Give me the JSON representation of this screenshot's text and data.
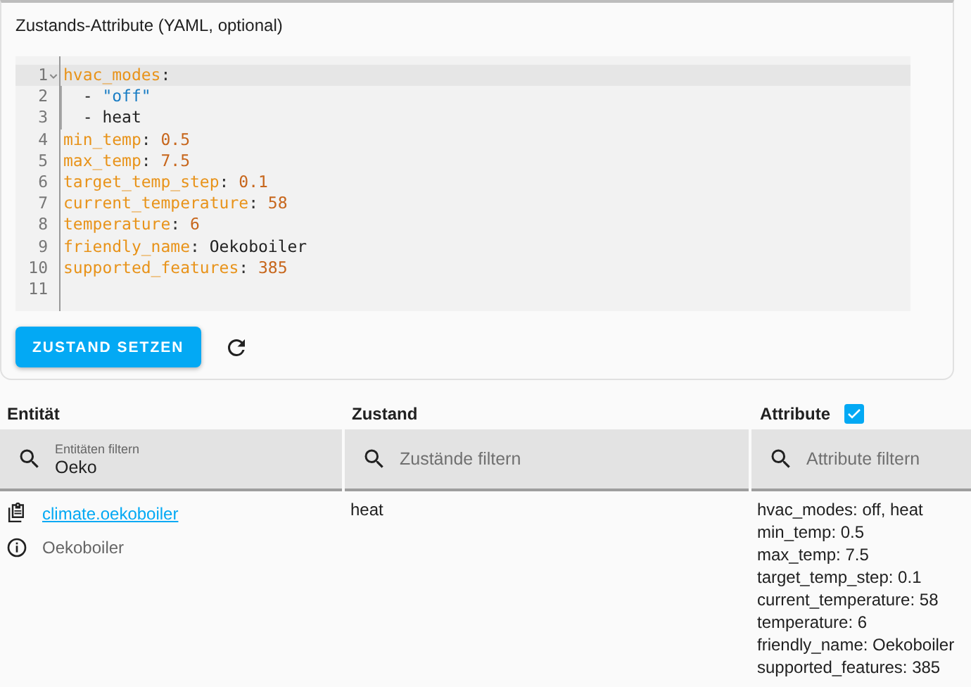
{
  "attributes_card": {
    "label": "Zustands-Attribute (YAML, optional)",
    "editor_lines": [
      {
        "number": "1",
        "foldable": true,
        "active": true,
        "indent_guide": false,
        "tokens": [
          {
            "text": "hvac_modes",
            "kind": "key"
          },
          {
            "text": ":",
            "kind": "punct"
          }
        ]
      },
      {
        "number": "2",
        "foldable": false,
        "active": false,
        "indent_guide": true,
        "tokens": [
          {
            "text": "  - ",
            "kind": "plain"
          },
          {
            "text": "\"off\"",
            "kind": "string"
          }
        ]
      },
      {
        "number": "3",
        "foldable": false,
        "active": false,
        "indent_guide": true,
        "tokens": [
          {
            "text": "  - heat",
            "kind": "plain"
          }
        ]
      },
      {
        "number": "4",
        "foldable": false,
        "active": false,
        "indent_guide": false,
        "tokens": [
          {
            "text": "min_temp",
            "kind": "key"
          },
          {
            "text": ": ",
            "kind": "punct"
          },
          {
            "text": "0.5",
            "kind": "number"
          }
        ]
      },
      {
        "number": "5",
        "foldable": false,
        "active": false,
        "indent_guide": false,
        "tokens": [
          {
            "text": "max_temp",
            "kind": "key"
          },
          {
            "text": ": ",
            "kind": "punct"
          },
          {
            "text": "7.5",
            "kind": "number"
          }
        ]
      },
      {
        "number": "6",
        "foldable": false,
        "active": false,
        "indent_guide": false,
        "tokens": [
          {
            "text": "target_temp_step",
            "kind": "key"
          },
          {
            "text": ": ",
            "kind": "punct"
          },
          {
            "text": "0.1",
            "kind": "number"
          }
        ]
      },
      {
        "number": "7",
        "foldable": false,
        "active": false,
        "indent_guide": false,
        "tokens": [
          {
            "text": "current_temperature",
            "kind": "key"
          },
          {
            "text": ": ",
            "kind": "punct"
          },
          {
            "text": "58",
            "kind": "number"
          }
        ]
      },
      {
        "number": "8",
        "foldable": false,
        "active": false,
        "indent_guide": false,
        "tokens": [
          {
            "text": "temperature",
            "kind": "key"
          },
          {
            "text": ": ",
            "kind": "punct"
          },
          {
            "text": "6",
            "kind": "number"
          }
        ]
      },
      {
        "number": "9",
        "foldable": false,
        "active": false,
        "indent_guide": false,
        "tokens": [
          {
            "text": "friendly_name",
            "kind": "key"
          },
          {
            "text": ": ",
            "kind": "punct"
          },
          {
            "text": "Oekoboiler",
            "kind": "plain"
          }
        ]
      },
      {
        "number": "10",
        "foldable": false,
        "active": false,
        "indent_guide": false,
        "tokens": [
          {
            "text": "supported_features",
            "kind": "key"
          },
          {
            "text": ": ",
            "kind": "punct"
          },
          {
            "text": "385",
            "kind": "number"
          }
        ]
      },
      {
        "number": "11",
        "foldable": false,
        "active": false
      }
    ],
    "set_button": "ZUSTAND SETZEN"
  },
  "table": {
    "columns": [
      {
        "title": "Entität",
        "filter": {
          "placeholder": "Entitäten filtern",
          "value": "Oeko"
        }
      },
      {
        "title": "Zustand",
        "filter": {
          "placeholder": "Zustände filtern"
        }
      },
      {
        "title": "Attribute",
        "checkbox": {
          "checked": true
        },
        "filter": {
          "placeholder": "Attribute filtern"
        }
      }
    ],
    "rows": [
      {
        "entity_id": "climate.oekoboiler",
        "friendly_name": "Oekoboiler",
        "state": "heat",
        "attributes": [
          "hvac_modes: off, heat",
          "min_temp: 0.5",
          "max_temp: 7.5",
          "target_temp_step: 0.1",
          "current_temperature: 58",
          "temperature: 6",
          "friendly_name: Oekoboiler",
          "supported_features: 385"
        ]
      }
    ]
  }
}
